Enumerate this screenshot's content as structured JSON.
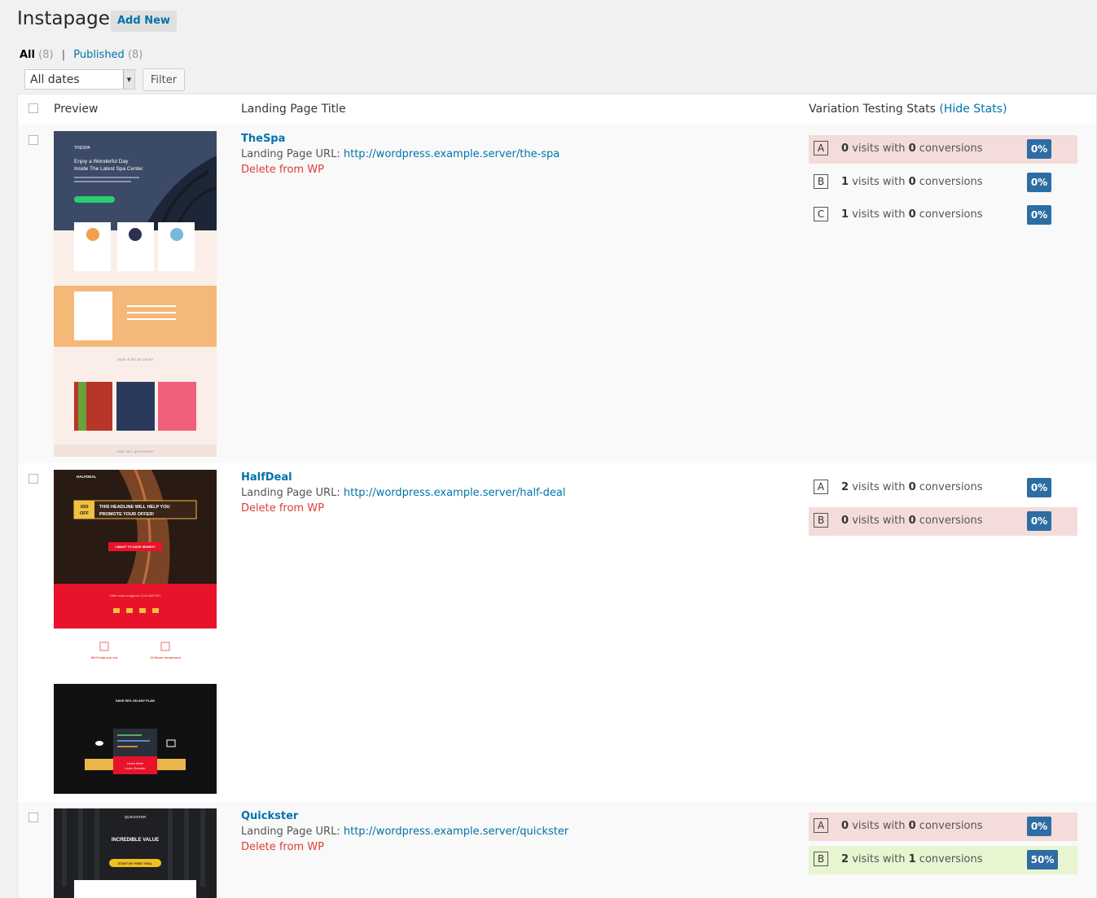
{
  "header": {
    "title": "Instapage",
    "add_new": "Add New"
  },
  "views": {
    "all_label": "All",
    "all_count": "(8)",
    "separator": "|",
    "published_label": "Published",
    "published_count": "(8)"
  },
  "filters": {
    "date_select": "All dates",
    "filter_button": "Filter"
  },
  "columns": {
    "preview": "Preview",
    "title": "Landing Page Title",
    "stats": "Variation Testing Stats",
    "hide_stats": "(Hide Stats)"
  },
  "labels": {
    "url_prefix": "Landing Page URL:",
    "delete": "Delete from WP"
  },
  "rows": [
    {
      "title": "TheSpa",
      "url": "http://wordpress.example.server/the-spa",
      "stats": [
        {
          "letter": "A",
          "visits": "0",
          "conversions": "0",
          "pct": "0%",
          "status": "red"
        },
        {
          "letter": "B",
          "visits": "1",
          "conversions": "0",
          "pct": "0%",
          "status": "none"
        },
        {
          "letter": "C",
          "visits": "1",
          "conversions": "0",
          "pct": "0%",
          "status": "none"
        }
      ]
    },
    {
      "title": "HalfDeal",
      "url": "http://wordpress.example.server/half-deal",
      "stats": [
        {
          "letter": "A",
          "visits": "2",
          "conversions": "0",
          "pct": "0%",
          "status": "none"
        },
        {
          "letter": "B",
          "visits": "0",
          "conversions": "0",
          "pct": "0%",
          "status": "red"
        }
      ]
    },
    {
      "title": "Quickster",
      "url": "http://wordpress.example.server/quickster",
      "stats": [
        {
          "letter": "A",
          "visits": "0",
          "conversions": "0",
          "pct": "0%",
          "status": "red"
        },
        {
          "letter": "B",
          "visits": "2",
          "conversions": "1",
          "pct": "50%",
          "status": "green"
        }
      ]
    }
  ],
  "stat_words": {
    "visits_with": "visits with",
    "conversions": "conversions"
  },
  "thumbnails": {
    "thespa": {
      "brand": "THESPA",
      "headline_1": "Enjoy a Wonderful Day",
      "headline_2": "Inside The Latest Spa Center",
      "section": "State of the art Center",
      "footer": "How can I get access?"
    },
    "halfdeal": {
      "brand": "HALFDEAL",
      "badge_1": "X50",
      "badge_2": "OFF",
      "headline_1": "THIS HEADLINE WILL HELP YOU",
      "headline_2": "PROMOTE YOUR OFFER!",
      "cta": "I WANT TO SAVE MONEY!",
      "offer": "Offer ends tonight at 12:00 AM PST",
      "feature_1": "We'll help you out",
      "feature_2": "24 Hours turnaround",
      "save": "SAVE 50% ON ANY PLAN",
      "learn_1": "Learn More",
      "learn_2": "Learn Smarter"
    },
    "quickster": {
      "brand": "QUICKSTER",
      "headline": "INCREDIBLE VALUE",
      "cta": "START MY FREE TRIAL"
    }
  }
}
